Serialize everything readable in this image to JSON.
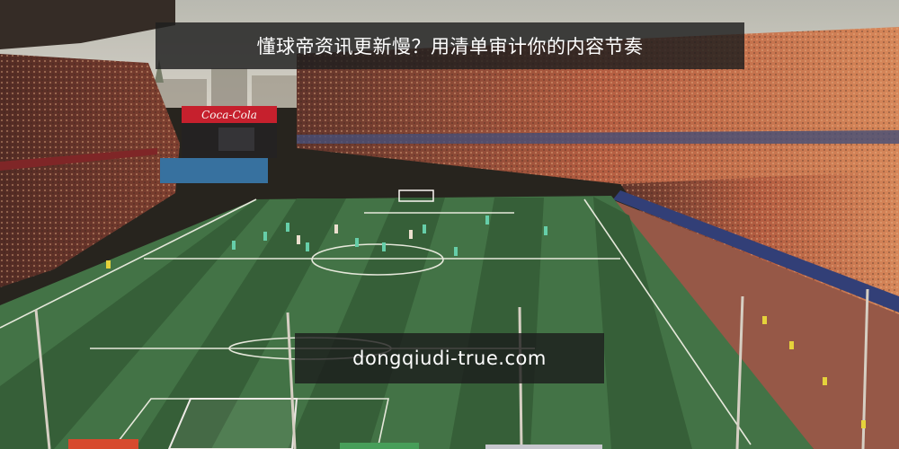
{
  "overlay": {
    "title": "懂球帝资讯更新慢？用清单审计你的内容节奏",
    "watermark": "dongqiudi-true.com"
  },
  "photo": {
    "subject": "football-stadium-aerial",
    "colors": {
      "sky": "#c9cdc8",
      "crowd_warm": "#b0563e",
      "crowd_dark": "#3a2422",
      "pitch_light": "#3f7a4a",
      "pitch_dark": "#2f6139",
      "line": "#e8eee6",
      "track": "#9a5a48"
    },
    "billboard": {
      "brand_text": "Coca-Cola"
    }
  }
}
